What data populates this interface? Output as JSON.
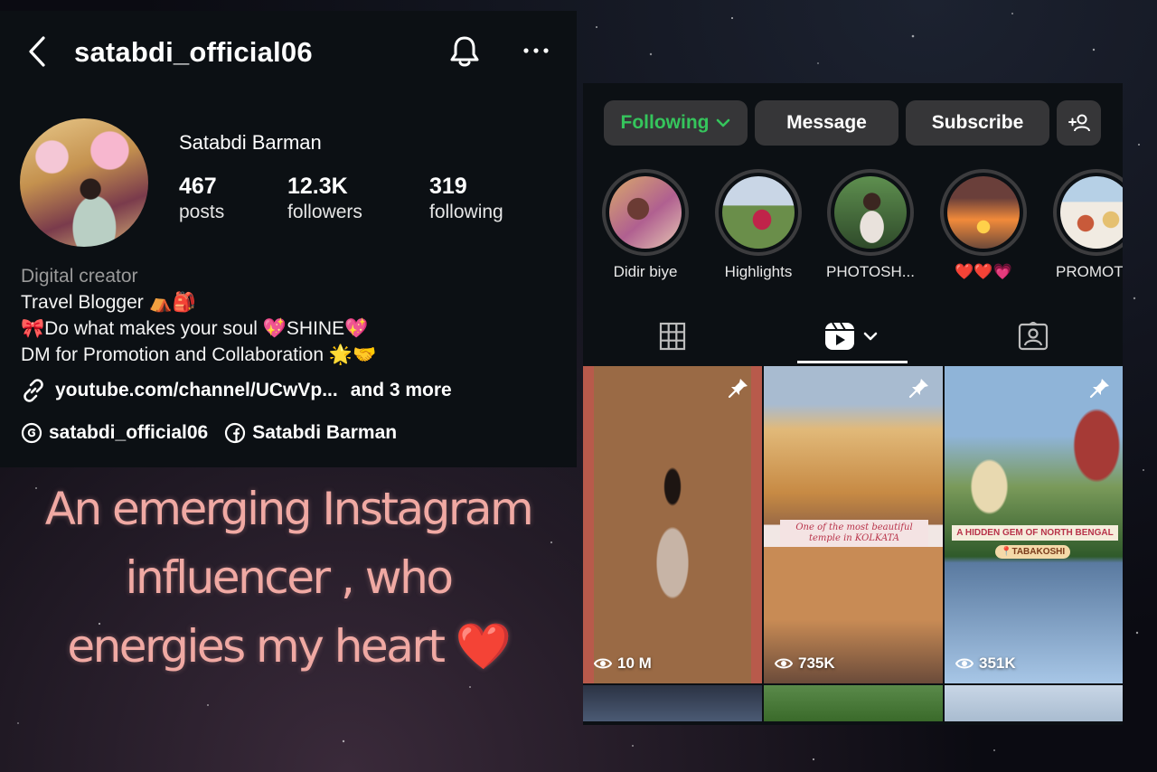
{
  "profile": {
    "username": "satabdi_official06",
    "display_name": "Satabdi Barman",
    "stats": [
      {
        "value": "467",
        "label": "posts"
      },
      {
        "value": "12.3K",
        "label": "followers"
      },
      {
        "value": "319",
        "label": "following"
      }
    ],
    "category": "Digital creator",
    "bio": [
      "Travel Blogger ⛺🎒",
      "🎀Do what makes your soul 💖SHINE💖",
      "DM for Promotion and Collaboration 🌟🤝"
    ],
    "link_text": "youtube.com/channel/UCwVp...",
    "link_more": "and 3 more",
    "threads_handle": "satabdi_official06",
    "facebook_name": "Satabdi Barman"
  },
  "actions": {
    "following": "Following",
    "message": "Message",
    "subscribe": "Subscribe"
  },
  "highlights": [
    {
      "label": "Didir biye"
    },
    {
      "label": "Highlights"
    },
    {
      "label": "PHOTOSH..."
    },
    {
      "label": "❤️❤️💗"
    },
    {
      "label": "PROMOTI"
    }
  ],
  "tabs": [
    "grid",
    "reels",
    "tagged"
  ],
  "reels": [
    {
      "views": "10 M",
      "overlay": ""
    },
    {
      "views": "735K",
      "overlay": "One of the most beautiful temple in KOLKATA"
    },
    {
      "views": "351K",
      "overlay": "A HIDDEN GEM OF NORTH BENGAL",
      "tag": "📍TABAKOSHI"
    }
  ],
  "caption": {
    "line1": "An emerging Instagram",
    "line2": "influencer , who",
    "line3": "energies my heart ❤️"
  },
  "colors": {
    "panel_bg": "#0c1014",
    "button_bg": "#363638",
    "following_green": "#35c55c",
    "caption_pink": "#f0a9a3"
  }
}
